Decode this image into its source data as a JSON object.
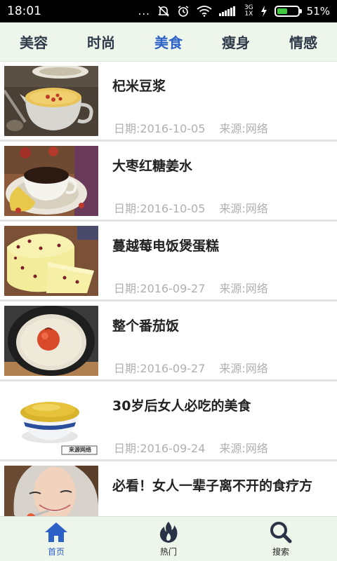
{
  "status_bar": {
    "time": "18:01",
    "dots": "...",
    "network_top": "3G",
    "network_bottom": "1X",
    "battery": "51%",
    "battery_level": 0.51
  },
  "tabs": [
    {
      "label": "美容"
    },
    {
      "label": "时尚"
    },
    {
      "label": "美食"
    },
    {
      "label": "瘦身"
    },
    {
      "label": "情感"
    }
  ],
  "active_tab": "美食",
  "articles": [
    {
      "title": "杞米豆浆",
      "date": "日期:2016-10-05",
      "source": "来源:网络"
    },
    {
      "title": "大枣红糖姜水",
      "date": "日期:2016-10-05",
      "source": "来源:网络"
    },
    {
      "title": "蔓越莓电饭煲蛋糕",
      "date": "日期:2016-09-27",
      "source": "来源:网络"
    },
    {
      "title": "整个番茄饭",
      "date": "日期:2016-09-27",
      "source": "来源:网络"
    },
    {
      "title": "30岁后女人必吃的美食",
      "date": "日期:2016-09-24",
      "source": "来源:网络"
    },
    {
      "title": "必看！女人一辈子离不开的食疗方",
      "date": "",
      "source": ""
    }
  ],
  "thumb_watermark": "来源网络",
  "bottom_nav": [
    {
      "label": "首页",
      "icon": "home-icon"
    },
    {
      "label": "热门",
      "icon": "flame-icon"
    },
    {
      "label": "搜索",
      "icon": "search-icon"
    }
  ],
  "colors": {
    "accent": "#2c62c8",
    "tab_bar_bg": "#eef5ea",
    "meta_text": "#b0b0b0"
  }
}
